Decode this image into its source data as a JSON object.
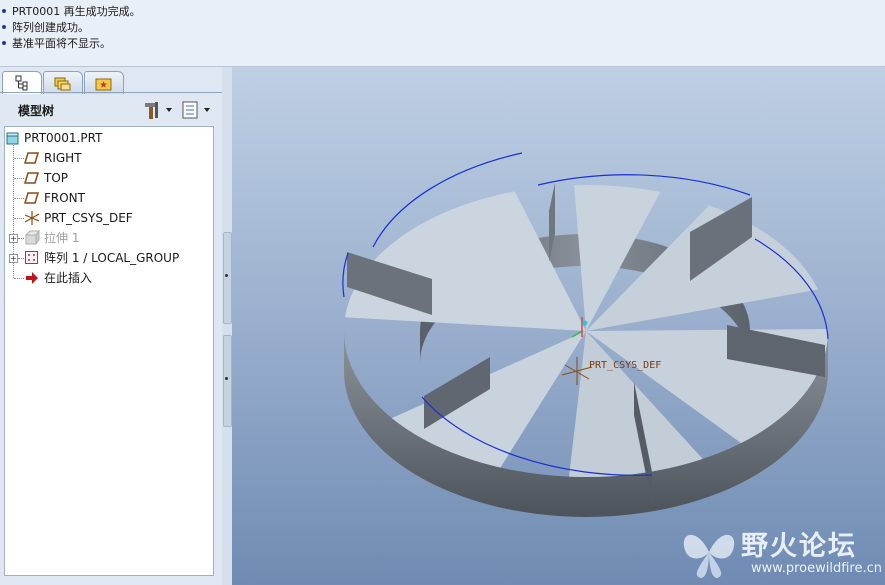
{
  "messages": [
    "PRT0001 再生成功完成。",
    "阵列创建成功。",
    "基准平面将不显示。"
  ],
  "tabs": [
    {
      "icon": "model-tree-icon"
    },
    {
      "icon": "folder-browser-icon"
    },
    {
      "icon": "favorites-icon"
    }
  ],
  "tree_header": {
    "title": "模型树",
    "settings_icon": "settings-tools-icon",
    "show_icon": "show-list-icon"
  },
  "tree": {
    "root": "PRT0001.PRT",
    "items": [
      {
        "label": "RIGHT",
        "icon": "datum-plane-icon"
      },
      {
        "label": "TOP",
        "icon": "datum-plane-icon"
      },
      {
        "label": "FRONT",
        "icon": "datum-plane-icon"
      },
      {
        "label": "PRT_CSYS_DEF",
        "icon": "csys-icon"
      },
      {
        "label": "拉伸 1",
        "icon": "extrude-icon",
        "grayed": true
      },
      {
        "label": "阵列 1 / LOCAL_GROUP",
        "icon": "pattern-icon"
      },
      {
        "label": "在此插入",
        "icon": "insert-arrow-icon"
      }
    ]
  },
  "viewport": {
    "csys_label": "PRT_CSYS_DEF",
    "watermark_title": "野火论坛",
    "watermark_url": "www.proewildfire.cn"
  },
  "colors": {
    "edge_highlight": "#1a2fd6",
    "model_face": "#c9d3dd",
    "model_side": "#5f6670",
    "viewport_top": "#bfd0e4",
    "viewport_bottom": "#6f8bb3"
  }
}
